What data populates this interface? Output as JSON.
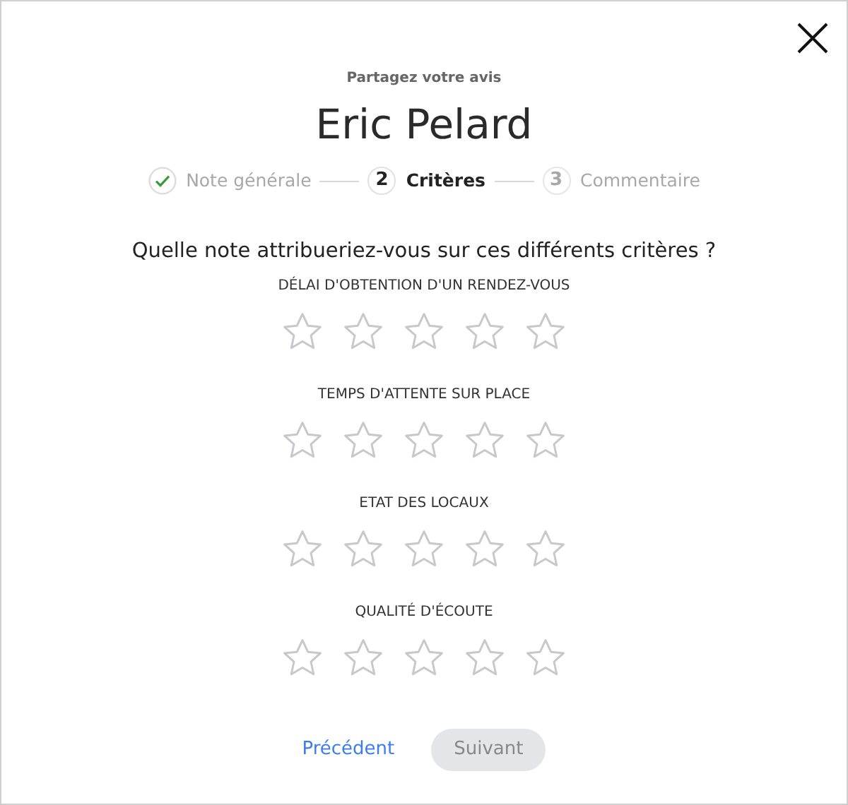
{
  "subtitle": "Partagez votre avis",
  "title": "Eric Pelard",
  "steps": [
    {
      "label": "Note générale",
      "completed": true,
      "selected": false
    },
    {
      "number": "2",
      "label": "Critères",
      "completed": false,
      "selected": true
    },
    {
      "number": "3",
      "label": "Commentaire",
      "completed": false,
      "selected": false
    }
  ],
  "question": "Quelle note attribueriez-vous sur ces différents critères ?",
  "criteria": [
    {
      "label": "DÉLAI D'OBTENTION D'UN RENDEZ-VOUS",
      "stars": 0
    },
    {
      "label": "TEMPS D'ATTENTE SUR PLACE",
      "stars": 0
    },
    {
      "label": "ETAT DES LOCAUX",
      "stars": 0
    },
    {
      "label": "QUALITÉ D'ÉCOUTE",
      "stars": 0
    }
  ],
  "buttons": {
    "previous": "Précédent",
    "next": {
      "label": "Suivant",
      "disabled": true
    }
  }
}
